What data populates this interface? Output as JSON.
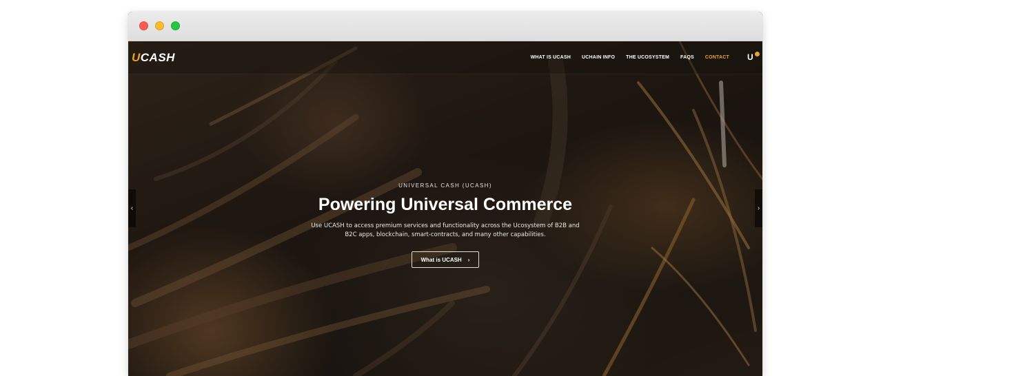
{
  "window": {
    "controls": [
      "close",
      "minimize",
      "zoom"
    ]
  },
  "brand": {
    "logo_accent": "U",
    "logo_rest": "CASH",
    "accent_color": "#e8a22c"
  },
  "nav": {
    "items": [
      {
        "label": "WHAT IS UCASH"
      },
      {
        "label": "UCHAIN INFO"
      },
      {
        "label": "THE UCOSYSTEM"
      },
      {
        "label": "FAQS"
      },
      {
        "label": "CONTACT"
      }
    ],
    "wallet_icon": "u-wallet-icon"
  },
  "hero": {
    "eyebrow": "UNIVERSAL CASH (UCASH)",
    "headline": "Powering Universal Commerce",
    "subtext": "Use UCASH to access premium services and functionality across the Ucosystem of B2B and B2C apps, blockchain, smart-contracts, and many other capabilities.",
    "cta_label": "What is UCASH",
    "cta_icon": "chevron-right-icon"
  },
  "slider": {
    "prev_icon": "chevron-left-icon",
    "next_icon": "chevron-right-icon"
  }
}
